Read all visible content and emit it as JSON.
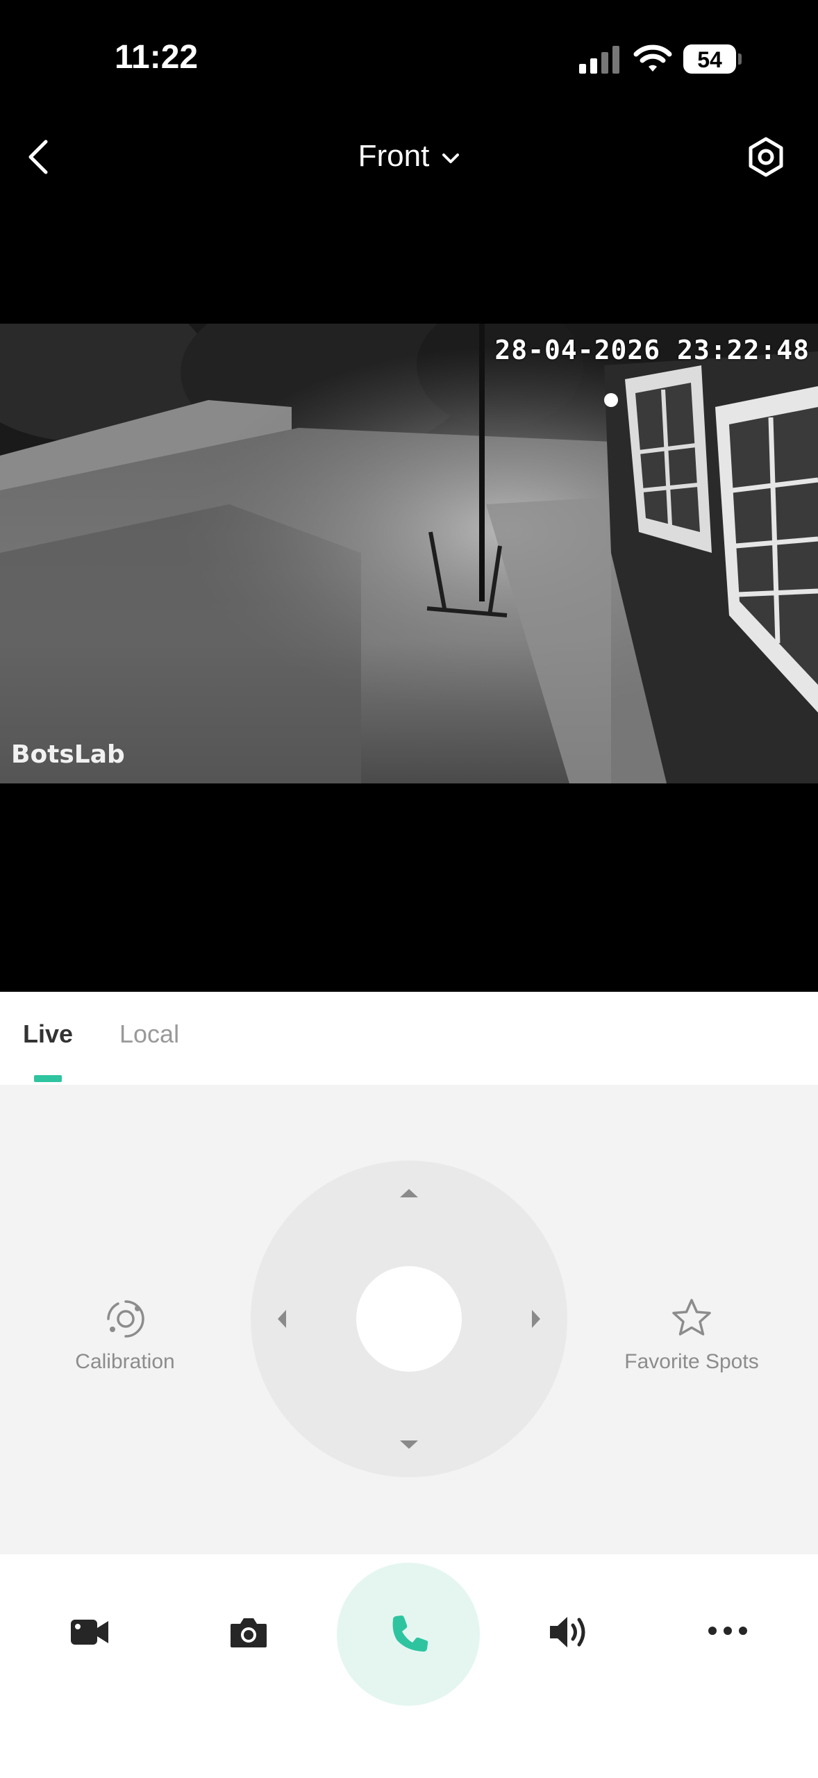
{
  "status_bar": {
    "time": "11:22",
    "battery": "54"
  },
  "header": {
    "title": "Front"
  },
  "video": {
    "timestamp": "28-04-2026 23:22:48",
    "brand": "BotsLab"
  },
  "tabs": [
    {
      "label": "Live"
    },
    {
      "label": "Local"
    }
  ],
  "controls": {
    "calibration_label": "Calibration",
    "favorite_label": "Favorite Spots"
  },
  "colors": {
    "accent": "#2ec4a0",
    "call_bg": "#e5f6f1"
  },
  "bottom_bar": {
    "icons": [
      "record-video-icon",
      "snapshot-camera-icon",
      "phone-call-icon",
      "speaker-volume-icon",
      "more-icon"
    ]
  }
}
